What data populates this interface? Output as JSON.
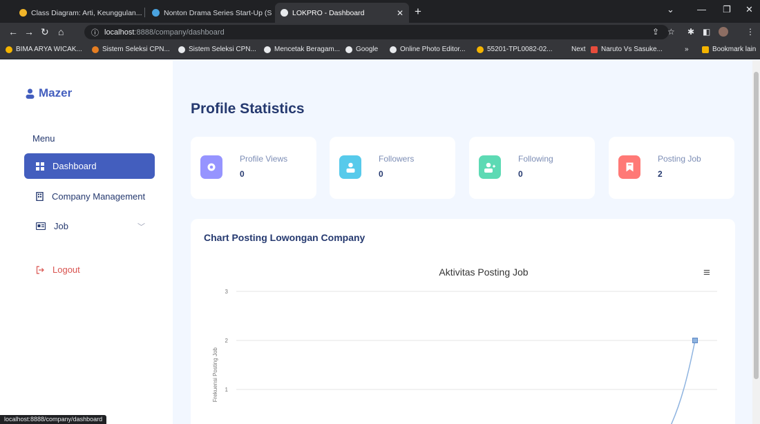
{
  "browser": {
    "tabs": [
      {
        "title": "Class Diagram: Arti, Keunggulan..."
      },
      {
        "title": "Nonton Drama Series Start-Up (S..."
      },
      {
        "title": "LOKPRO - Dashboard"
      }
    ],
    "url_host": "localhost",
    "url_path": ":8888/company/dashboard",
    "bookmarks": [
      "BIMA ARYA WICAK...",
      "Sistem Seleksi CPN...",
      "Sistem Seleksi CPN...",
      "Mencetak Beragam...",
      "Google",
      "Online Photo Editor...",
      "55201-TPL0082-02...",
      "Next",
      "Naruto Vs Sasuke...",
      "»",
      "Bookmark lain"
    ],
    "status_url": "localhost:8888/company/dashboard"
  },
  "sidebar": {
    "brand": "Mazer",
    "menu_title": "Menu",
    "items": [
      {
        "label": "Dashboard",
        "icon": "grid-icon"
      },
      {
        "label": "Company Management",
        "icon": "building-icon"
      },
      {
        "label": "Job",
        "icon": "card-icon"
      }
    ],
    "logout": "Logout"
  },
  "main": {
    "title": "Profile Statistics",
    "stats": [
      {
        "label": "Profile Views",
        "value": "0",
        "icon": "eye-icon",
        "color": "#9694ff"
      },
      {
        "label": "Followers",
        "value": "0",
        "icon": "user-icon",
        "color": "#57caeb"
      },
      {
        "label": "Following",
        "value": "0",
        "icon": "user-plus-icon",
        "color": "#5ddab4"
      },
      {
        "label": "Posting Job",
        "value": "2",
        "icon": "bookmark-icon",
        "color": "#ff7976"
      }
    ],
    "chart_heading": "Chart Posting Lowongan Company"
  },
  "chart_data": {
    "type": "line",
    "title": "Aktivitas Posting Job",
    "ylabel": "Frekuensi Posting Job",
    "xlabel": "",
    "ylim": [
      0,
      3
    ],
    "yticks": [
      "3",
      "2",
      "1"
    ],
    "color": "#8fb4e0",
    "series": [
      {
        "values": [
          2
        ]
      }
    ]
  }
}
